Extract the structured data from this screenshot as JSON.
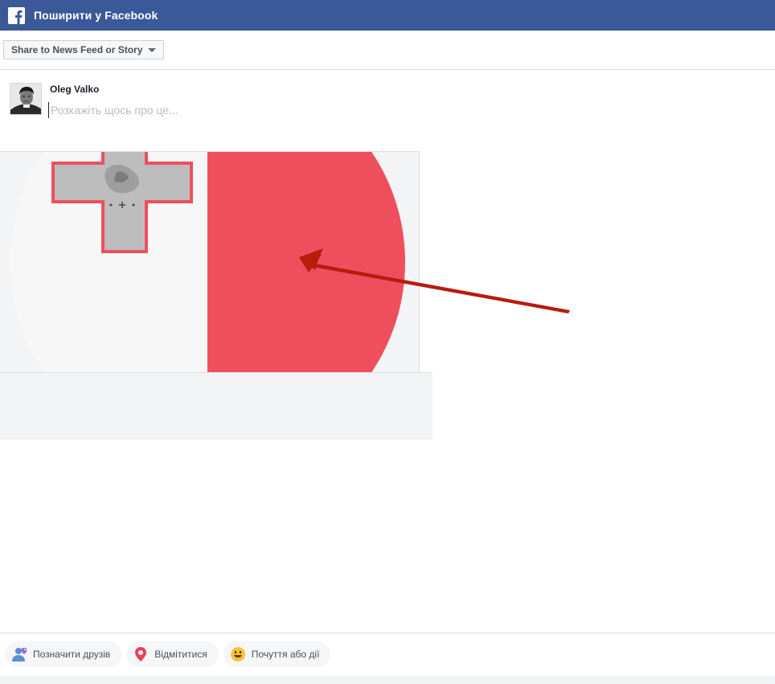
{
  "header": {
    "title": "Поширити у Facebook",
    "logo_icon": "facebook-f-icon",
    "background_color": "#3b5998"
  },
  "share_target": {
    "selected": "Share to News Feed or Story"
  },
  "composer": {
    "user_name": "Oleg Valko",
    "placeholder": "Розкажіть щось про це..."
  },
  "link_preview": {
    "image": "malta-flag",
    "flag_colors": {
      "white": "#f6f7f9",
      "red": "#ef4f5d",
      "cross": "#bbbbbb"
    },
    "annotation_arrow_color": "#b71c0c",
    "domain": "",
    "title": "",
    "description": ""
  },
  "actions": [
    {
      "label": "Позначити друзів",
      "icon": "tag-friends-icon"
    },
    {
      "label": "Відмітитися",
      "icon": "location-pin-icon"
    },
    {
      "label": "Почуття або дії",
      "icon": "smiley-icon"
    }
  ]
}
